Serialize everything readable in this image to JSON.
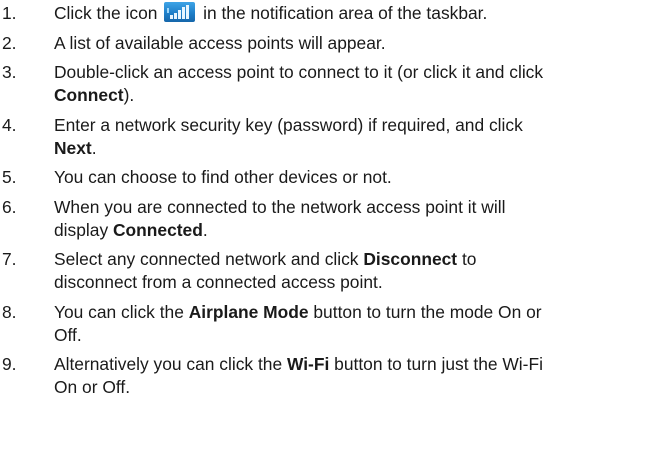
{
  "steps": [
    {
      "number": "1.",
      "parts": [
        "Click the icon",
        "in the notification area of the taskbar."
      ],
      "icon": "wifi-signal-icon"
    },
    {
      "number": "2.",
      "text": "A list of available access points will appear."
    },
    {
      "number": "3.",
      "line1": "Double-click an access point to connect to it (or click it and click",
      "bold": "Connect",
      "after": ")."
    },
    {
      "number": "4.",
      "line1": "Enter a network security key (password) if required, and click",
      "bold": "Next",
      "after": "."
    },
    {
      "number": "5.",
      "text": "You can choose to find other devices or not."
    },
    {
      "number": "6.",
      "line1": "When you are connected to the network access point it will",
      "before": "display",
      "bold": "Connected",
      "after": "."
    },
    {
      "number": "7.",
      "before": "Select any connected network and click",
      "bold": "Disconnect",
      "after": "to",
      "line2": "disconnect from a connected access point."
    },
    {
      "number": "8.",
      "before": "You can click the",
      "bold": "Airplane Mode",
      "after": "button to turn the mode On or",
      "line2": "Off."
    },
    {
      "number": "9.",
      "before": "Alternatively you can click the",
      "bold": "Wi-Fi",
      "after": "button to turn just the Wi-Fi",
      "line2": "On or Off."
    }
  ]
}
